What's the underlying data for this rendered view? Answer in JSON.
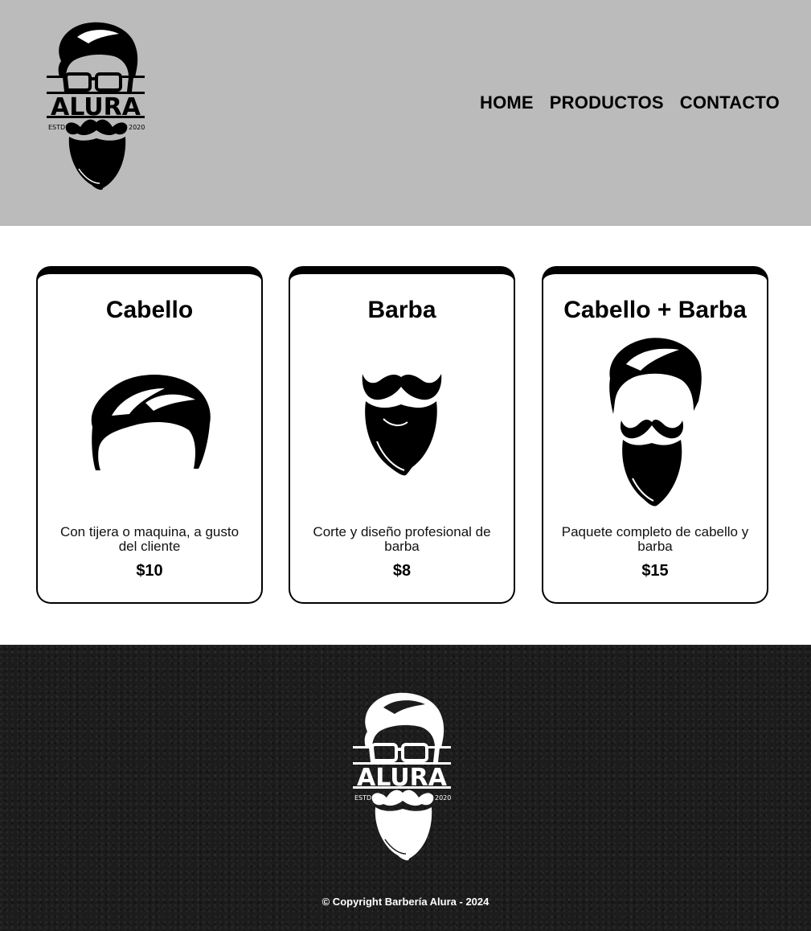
{
  "brand": {
    "logo_text": "ALURA",
    "logo_left": "ESTD",
    "logo_right": "2020"
  },
  "nav": {
    "items": [
      {
        "label": "HOME"
      },
      {
        "label": "PRODUCTOS"
      },
      {
        "label": "CONTACTO"
      }
    ]
  },
  "products": [
    {
      "title": "Cabello",
      "description": "Con tijera o maquina, a gusto del cliente",
      "price": "$10",
      "icon": "hair-icon"
    },
    {
      "title": "Barba",
      "description": "Corte y diseño profesional de barba",
      "price": "$8",
      "icon": "beard-icon"
    },
    {
      "title": "Cabello + Barba",
      "description": "Paquete completo de cabello y barba",
      "price": "$15",
      "icon": "hair-and-beard-icon"
    }
  ],
  "footer": {
    "copyright": "© Copyright Barbería Alura - 2024"
  },
  "colors": {
    "header_bg": "#bbbbbb",
    "footer_bg": "#1c1c1c"
  }
}
